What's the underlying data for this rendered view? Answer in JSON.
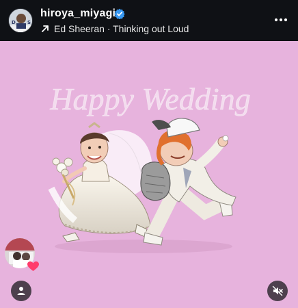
{
  "post": {
    "username": "hiroya_miyagi",
    "verified_icon": "verified-badge-icon",
    "music": {
      "icon": "arrow-up-right-icon",
      "text": "Ed Sheeran · Thinking out Loud"
    },
    "more_icon": "more-options-icon"
  },
  "media": {
    "background_color": "#e7b3dd",
    "overlay_title": "Happy Wedding"
  },
  "controls": {
    "tagged_user_icon": "user-icon",
    "mute_icon": "speaker-muted-icon",
    "reaction_icon": "heart-icon"
  },
  "colors": {
    "verified_blue": "#3797f0",
    "heart": "#ff3b6b"
  }
}
